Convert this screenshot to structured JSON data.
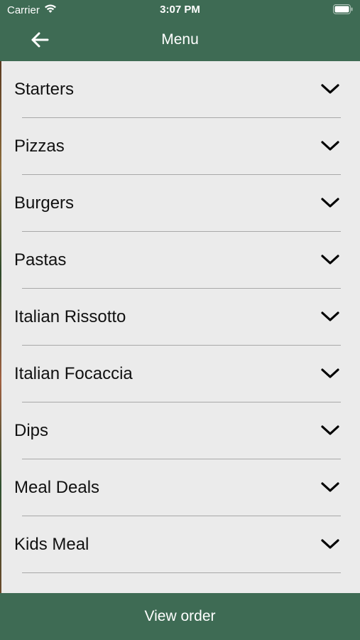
{
  "status_bar": {
    "carrier": "Carrier",
    "time": "3:07 PM"
  },
  "nav": {
    "title": "Menu",
    "back_icon": "arrow-left-icon"
  },
  "colors": {
    "header": "#3e6b54",
    "list_background": "#ebebeb",
    "divider": "#a8a8a8"
  },
  "menu": {
    "items": [
      {
        "label": "Starters"
      },
      {
        "label": "Pizzas"
      },
      {
        "label": "Burgers"
      },
      {
        "label": "Pastas"
      },
      {
        "label": "Italian Rissotto"
      },
      {
        "label": "Italian Focaccia"
      },
      {
        "label": "Dips"
      },
      {
        "label": "Meal Deals"
      },
      {
        "label": "Kids Meal"
      }
    ]
  },
  "footer": {
    "view_order_label": "View order"
  }
}
